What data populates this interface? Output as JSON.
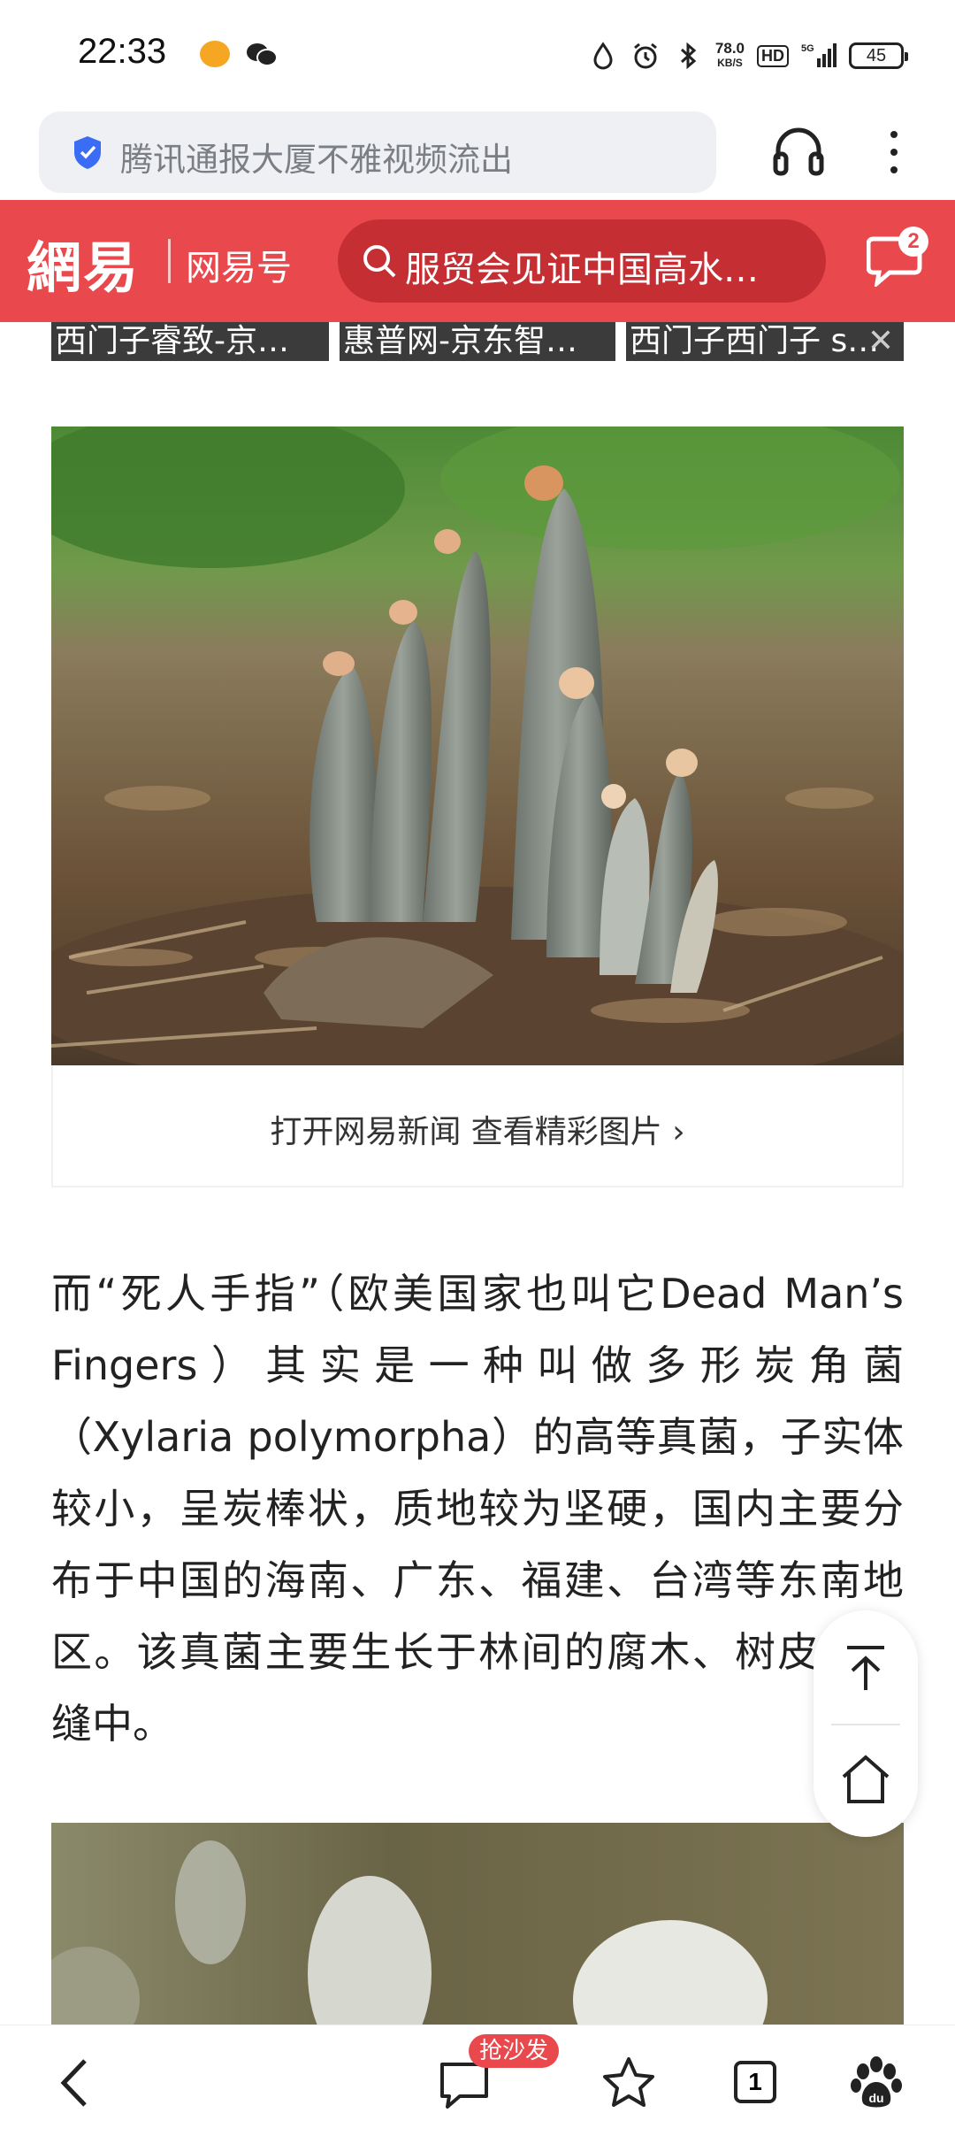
{
  "status_bar": {
    "time": "22:33",
    "net_speed_value": "78.0",
    "net_speed_unit": "KB/S",
    "hd_label": "HD",
    "network_label": "5G",
    "battery": "45"
  },
  "browser": {
    "url_text": "腾讯通报大厦不雅视频流出"
  },
  "header": {
    "logo": "網易",
    "brand_sub": "网易号",
    "search_text": "服贸会见证中国高水…",
    "message_badge": "2"
  },
  "ad_strip": {
    "items": [
      "西门子睿致-京…",
      "惠普网-京东智…",
      "西门子西门子 s…"
    ],
    "close_symbol": "✕"
  },
  "image_caption": "打开网易新闻 查看精彩图片 ›",
  "article": {
    "paragraph": "而“死人手指”（欧美国家也叫它Dead Man’s Fingers）其实是一种叫做多形炭角菌（Xylaria polymorpha）的高等真菌，子实体较小，呈炭棒状，质地较为坚硬，国内主要分布于中国的海南、广东、福建、台湾等东南地区。该真菌主要生长于林间的腐木、树皮的裂缝中。"
  },
  "bottom_nav": {
    "comment_badge": "抢沙发",
    "tab_count": "1"
  },
  "colors": {
    "brand_red": "#e9484c",
    "search_red": "#c52f34",
    "url_bg": "#eef0f3"
  },
  "icons": [
    "shield-icon",
    "headphone-icon",
    "more-icon",
    "search-icon",
    "message-icon",
    "back-to-top-icon",
    "home-icon",
    "back-icon",
    "comment-icon",
    "star-icon",
    "tabs-icon",
    "baidu-paw-icon"
  ]
}
